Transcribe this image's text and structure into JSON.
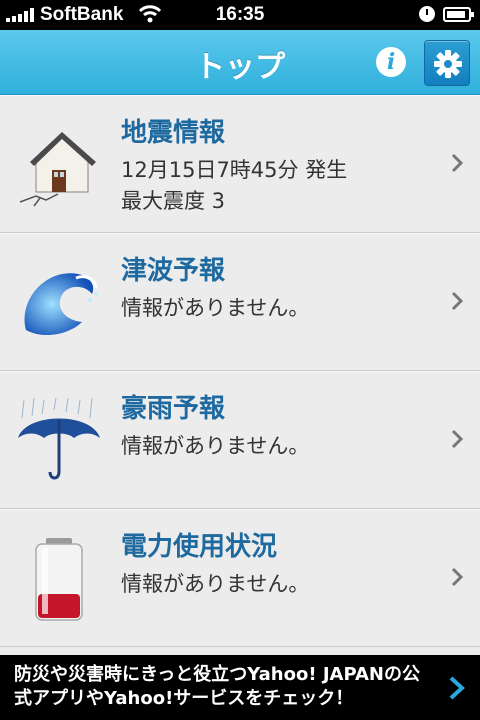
{
  "status_bar": {
    "carrier": "SoftBank",
    "time": "16:35"
  },
  "nav": {
    "title": "トップ",
    "info_icon": "info-icon",
    "settings_icon": "gear-icon"
  },
  "list": {
    "items": [
      {
        "icon": "house-earthquake-icon",
        "label": "地震情報",
        "line1": "12月15日7時45分 発生",
        "line2": "最大震度 3"
      },
      {
        "icon": "tsunami-wave-icon",
        "label": "津波予報",
        "line1": "情報がありません。"
      },
      {
        "icon": "umbrella-rain-icon",
        "label": "豪雨予報",
        "line1": "情報がありません。"
      },
      {
        "icon": "battery-icon",
        "label": "電力使用状況",
        "line1": "情報がありません。"
      }
    ]
  },
  "banner": {
    "text": "防災や災害時にきっと役立つYahoo! JAPANの公式アプリやYahoo!サービスをチェック！"
  },
  "colors": {
    "nav_blue": "#3ab8e2",
    "label_blue": "#1e6aa0"
  }
}
